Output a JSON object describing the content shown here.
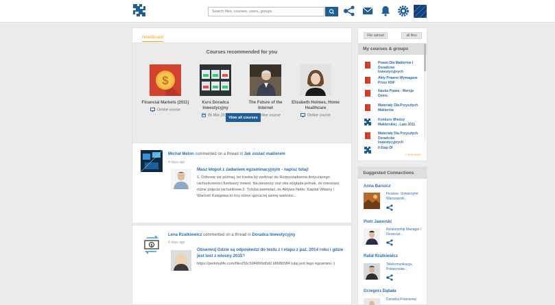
{
  "header": {
    "search_placeholder": "Search files, courses, users, groups"
  },
  "newsboard": {
    "tab_label": "NewsBoard",
    "recommended_title": "Courses recommended for you",
    "courses": [
      {
        "title": "Financial Markets (2011)",
        "meta": "Online course",
        "meta_icon": "monitor-icon"
      },
      {
        "title": "Kurs Doradca Inwestycyjny",
        "meta": "05 Mar 2016",
        "meta_icon": "calendar-icon"
      },
      {
        "title": "The Future of the Internet",
        "meta": "Online course",
        "meta_icon": "monitor-icon"
      },
      {
        "title": "Elizabeth Holmes, Home Healthcare",
        "meta": "Online course",
        "meta_icon": "monitor-icon"
      }
    ],
    "view_all_label": "View all courses"
  },
  "feed": [
    {
      "author": "Michał Melon",
      "action": " commented on a thread in ",
      "thread": "Jak zostać maklerem",
      "ago": "4 days ago",
      "post_title": "Masz kłopot z zadaniem egzaminacyjnym - napisz tutaj!",
      "post_body": "1. Odnosię się później, bo trzeba by zwrknąć do Rozporządzenia dotyczącego rachunkowości funduszy inwest. Na pierwszy rzut oka wygląda jednak, że mieszasz różne pojęcia rachunkowe.2. Trzeba pamiętać, że Aktywa Netto, Kapitał Własny i Wartość Księgowa to trzy różne ujęcia tej samej wartości..."
    },
    {
      "author": "Lena Rzatkiewicz",
      "action": " commented on a thread in ",
      "thread": "Doradca Inwestycyjny",
      "ago": "4 days ago",
      "post_title": "Obserwuj Gdzie są odpowiedzi do testu z I etapu z paź. 2014 roku i gdzie jest test z wiosny 2015?",
      "post_body": "https://perkmylife.com/files/56c59f4899d0d2.68686584 tutaj jest tego egzaminu :)"
    }
  ],
  "sidebar": {
    "file_upload_label": "File upload",
    "all_files_label": "all files",
    "groups_title": "My courses & groups",
    "groups": [
      {
        "label": "Prawo Dla Maklerów I Doradców Inwestycyjnych",
        "icon": "book-icon"
      },
      {
        "label": "Akty Prawne Wymagane Przez KNF",
        "icon": "book-icon"
      },
      {
        "label": "Nauka Prawa - Wersja Demo",
        "icon": "book-icon"
      },
      {
        "label": "Materiały Dla Przyszłych Maklerów",
        "icon": "book-icon"
      },
      {
        "label": "Konkurs Wiedzy Maklerskiej - Lato 2011",
        "icon": "logo-icon"
      },
      {
        "label": "Materiały Dla Przyszłych Doradców Inwestycyjnych",
        "icon": "book-icon"
      },
      {
        "label": "II Etap DI",
        "icon": "logo-icon"
      }
    ],
    "see_more_label": "» See more",
    "connections_title": "Suggested Connections",
    "connections": [
      {
        "name": "Anna Barszcz",
        "desc": "Finanse, Uniwersytet Warszawski..."
      },
      {
        "name": "Piotr Jaworski",
        "desc": "Relationship Manager / Financial..."
      },
      {
        "name": "Rafał Rzatkiewicz",
        "desc": "Telekomunikacja, Politechnike..."
      },
      {
        "name": "Grzegorz Dąbała",
        "desc": "Doradca Finansowy"
      }
    ]
  },
  "colors": {
    "brand_blue": "#1f5d96",
    "link_blue": "#2a6cae",
    "accent_orange": "#f4a020",
    "course_red": "#d2422f"
  }
}
